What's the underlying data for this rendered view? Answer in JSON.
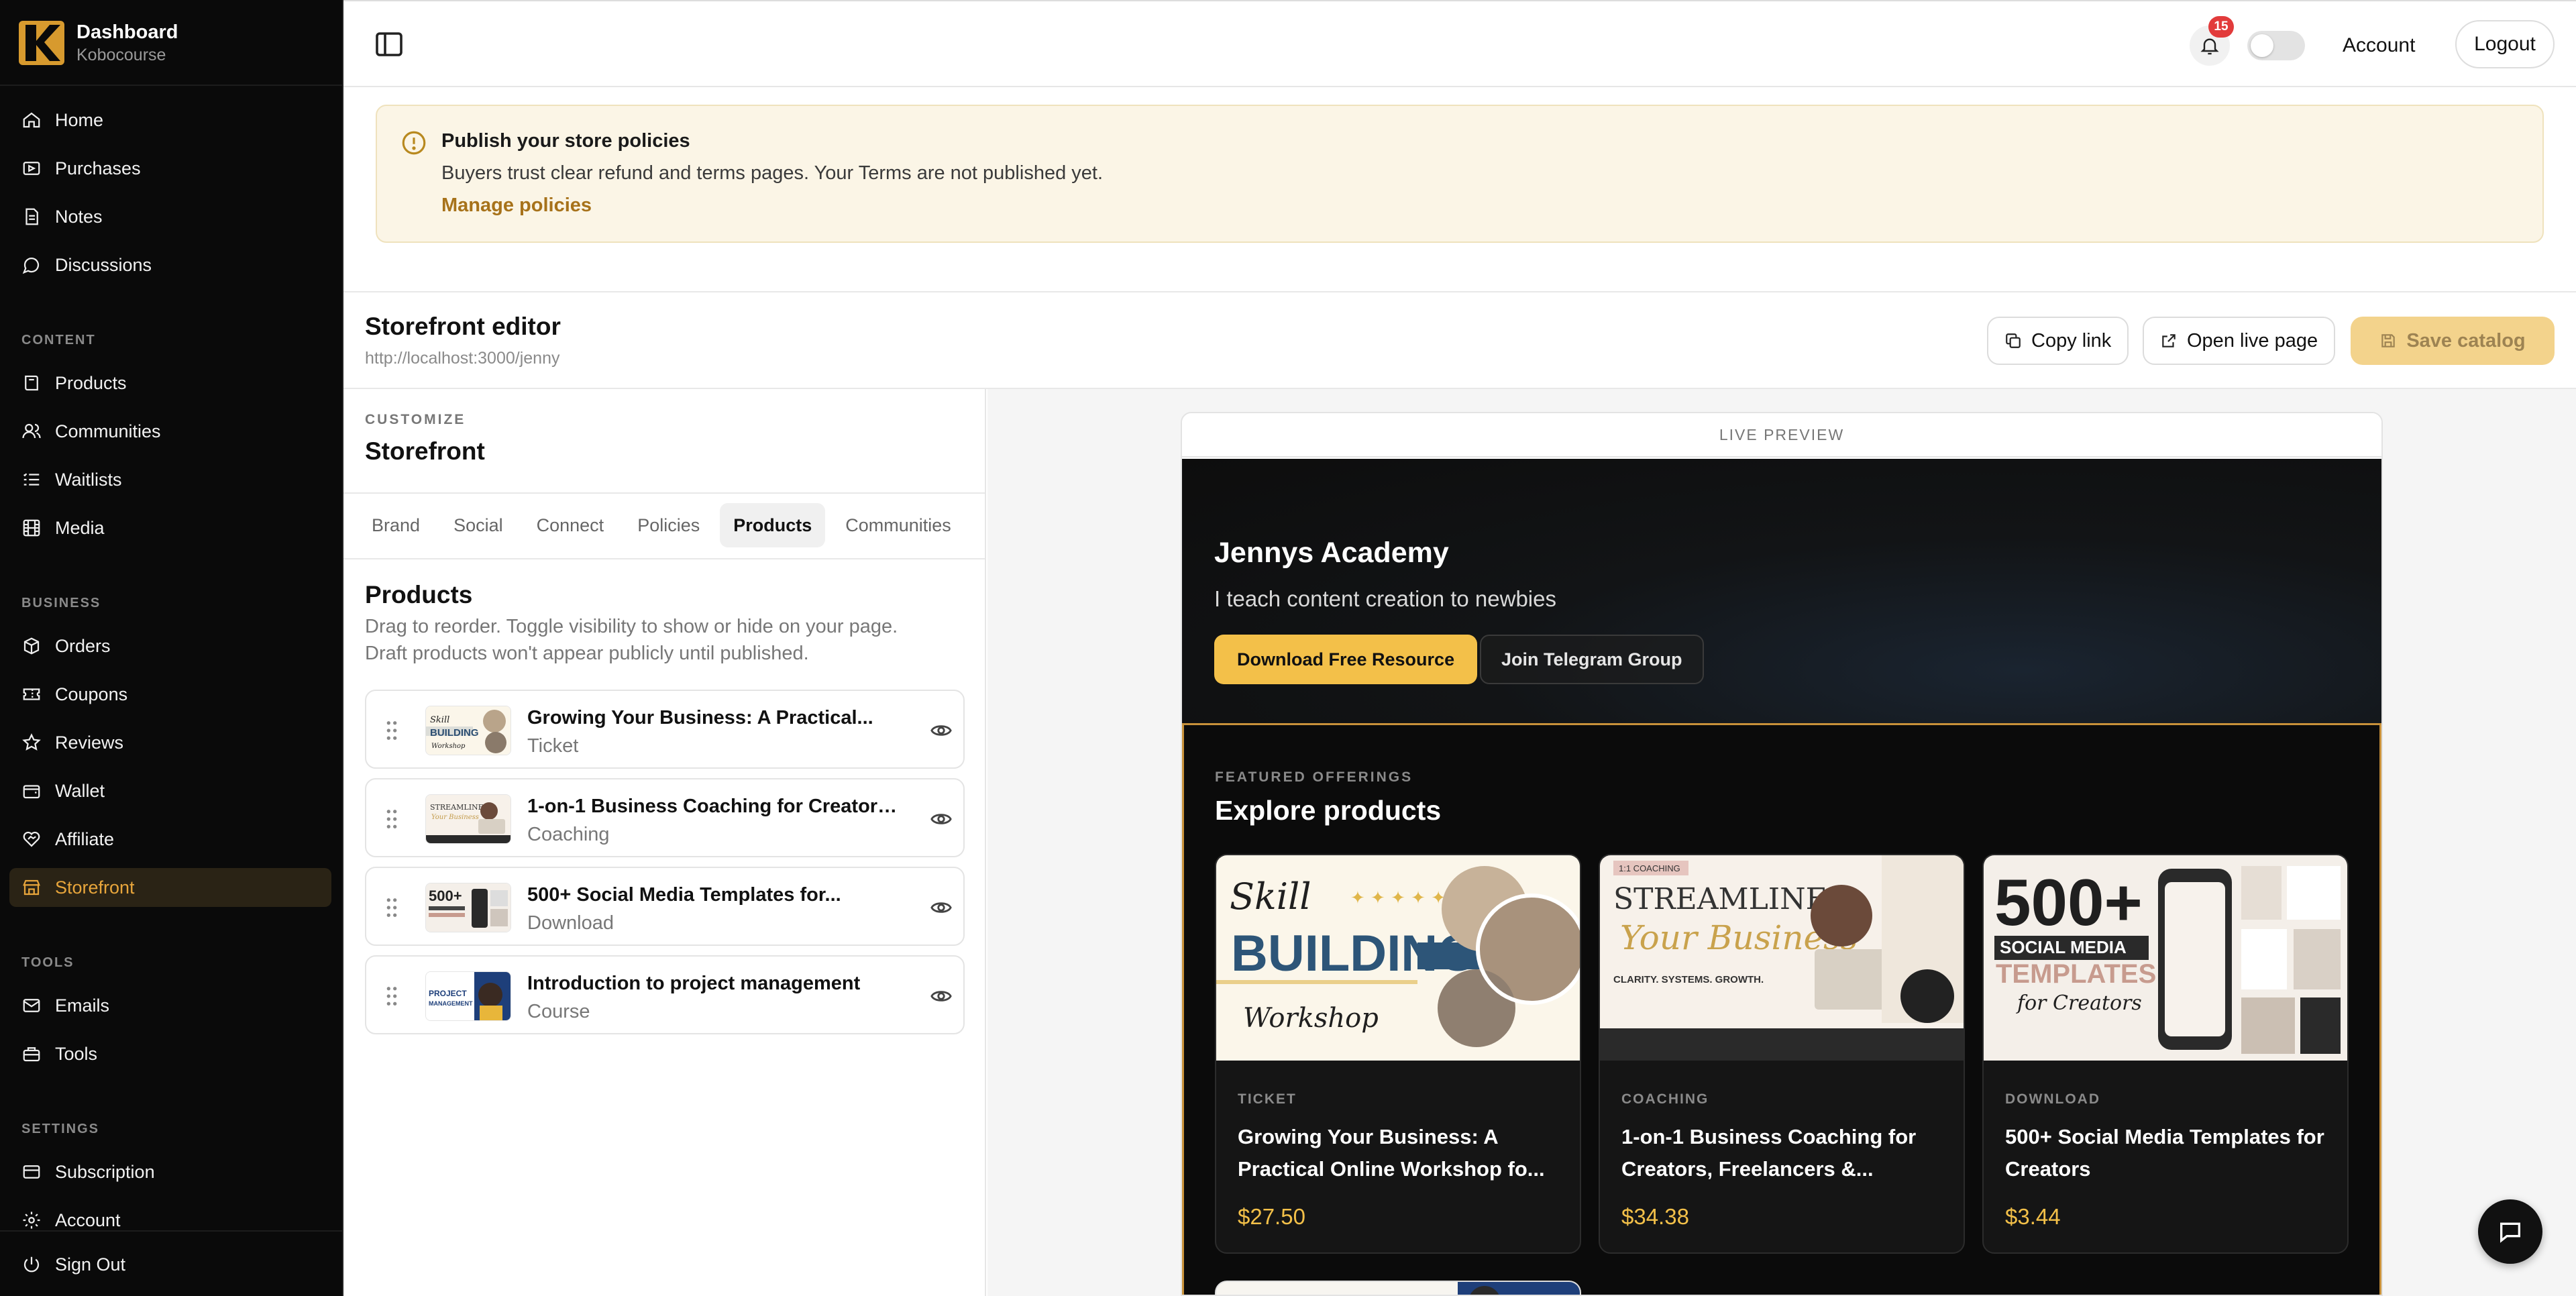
{
  "brand": {
    "title": "Dashboard",
    "subtitle": "Kobocourse",
    "logo_color": "#d79a2e"
  },
  "sidebar": {
    "main": [
      {
        "label": "Home",
        "icon": "home-icon"
      },
      {
        "label": "Purchases",
        "icon": "purchases-icon"
      },
      {
        "label": "Notes",
        "icon": "notes-icon"
      },
      {
        "label": "Discussions",
        "icon": "discussions-icon"
      }
    ],
    "content_heading": "CONTENT",
    "content": [
      {
        "label": "Products",
        "icon": "products-icon"
      },
      {
        "label": "Communities",
        "icon": "communities-icon"
      },
      {
        "label": "Waitlists",
        "icon": "waitlists-icon"
      },
      {
        "label": "Media",
        "icon": "media-icon"
      }
    ],
    "business_heading": "BUSINESS",
    "business": [
      {
        "label": "Orders",
        "icon": "orders-icon"
      },
      {
        "label": "Coupons",
        "icon": "coupons-icon"
      },
      {
        "label": "Reviews",
        "icon": "reviews-icon"
      },
      {
        "label": "Wallet",
        "icon": "wallet-icon"
      },
      {
        "label": "Affiliate",
        "icon": "affiliate-icon"
      },
      {
        "label": "Storefront",
        "icon": "storefront-icon",
        "active": true
      }
    ],
    "tools_heading": "TOOLS",
    "tools": [
      {
        "label": "Emails",
        "icon": "emails-icon"
      },
      {
        "label": "Tools",
        "icon": "tools-icon"
      }
    ],
    "settings_heading": "SETTINGS",
    "settings": [
      {
        "label": "Subscription",
        "icon": "subscription-icon"
      },
      {
        "label": "Account",
        "icon": "account-icon"
      }
    ],
    "sign_out": "Sign Out"
  },
  "topbar": {
    "notification_count": "15",
    "account": "Account",
    "logout": "Logout"
  },
  "banner": {
    "title": "Publish your store policies",
    "description": "Buyers trust clear refund and terms pages. Your Terms are not published yet.",
    "link": "Manage policies"
  },
  "editor": {
    "title": "Storefront editor",
    "url": "http://localhost:3000/jenny",
    "copy_link": "Copy link",
    "open_live": "Open live page",
    "save_catalog": "Save catalog"
  },
  "customize": {
    "label": "CUSTOMIZE",
    "title": "Storefront",
    "tabs": [
      "Brand",
      "Social",
      "Connect",
      "Policies",
      "Products",
      "Communities"
    ],
    "active_tab": "Products",
    "products_title": "Products",
    "products_desc": "Drag to reorder. Toggle visibility to show or hide on your page. Draft products won't appear publicly until published.",
    "products": [
      {
        "name": "Growing Your Business: A Practical...",
        "type": "Ticket"
      },
      {
        "name": "1-on-1 Business Coaching for Creators,...",
        "type": "Coaching"
      },
      {
        "name": "500+ Social Media Templates for...",
        "type": "Download"
      },
      {
        "name": "Introduction to project management",
        "type": "Course"
      }
    ]
  },
  "preview": {
    "label": "LIVE PREVIEW",
    "academy": "Jennys Academy",
    "tagline": "I teach content creation to newbies",
    "cta_primary": "Download Free Resource",
    "cta_secondary": "Join Telegram Group",
    "offer_label": "FEATURED OFFERINGS",
    "offer_title": "Explore products",
    "cards": [
      {
        "type": "TICKET",
        "title": "Growing Your Business: A Practical Online Workshop fo...",
        "price": "$27.50"
      },
      {
        "type": "COACHING",
        "title": "1-on-1 Business Coaching for Creators, Freelancers &...",
        "price": "$34.38"
      },
      {
        "type": "DOWNLOAD",
        "title": "500+ Social Media Templates for Creators",
        "price": "$3.44"
      }
    ],
    "thumb_text": {
      "skill": "Skill",
      "building": "BUILDING",
      "workshop": "Workshop",
      "streamline": "STREAMLINE",
      "your_business": "Your Business",
      "coaching_tag": "1:1 COACHING",
      "clarity": "CLARITY. SYSTEMS. GROWTH.",
      "n500": "500+",
      "social_media": "SOCIAL MEDIA",
      "templates": "TEMPLATES",
      "for_creators": "for Creators",
      "project": "PROJECT",
      "management": "MANAGEMENT"
    }
  },
  "colors": {
    "accent": "#e7a53b",
    "gold": "#f3c049",
    "badge": "#e23b3b"
  }
}
